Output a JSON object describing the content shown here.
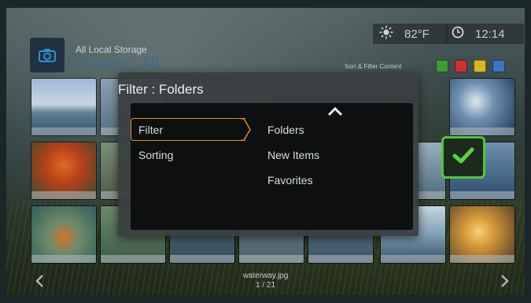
{
  "header": {
    "source": "All Local Storage",
    "section": "Photos : All",
    "temperature": "82°F",
    "time": "12:14",
    "sort_filter_label": "Sort & Filter Content"
  },
  "icons": {
    "app": "camera-icon",
    "weather": "sun-icon",
    "clock": "clock-icon",
    "confirm": "checkmark-icon",
    "scroll_up": "chevron-up-icon",
    "prev": "chevron-left-icon",
    "next": "chevron-right-icon"
  },
  "color_buttons": [
    "#3f9a3c",
    "#c8323a",
    "#d8b62a",
    "#3a74c0"
  ],
  "dialog": {
    "title": "Filter : Folders",
    "menu": [
      {
        "label": "Filter",
        "selected": true
      },
      {
        "label": "Sorting",
        "selected": false
      }
    ],
    "options": [
      "Folders",
      "New Items",
      "Favorites"
    ]
  },
  "footer": {
    "filename": "waterway.jpg",
    "counter": "1 / 21"
  },
  "colors": {
    "accent_orange": "#d98d3a",
    "confirm_green": "#55c43a",
    "title_blue": "#3a6e92"
  }
}
